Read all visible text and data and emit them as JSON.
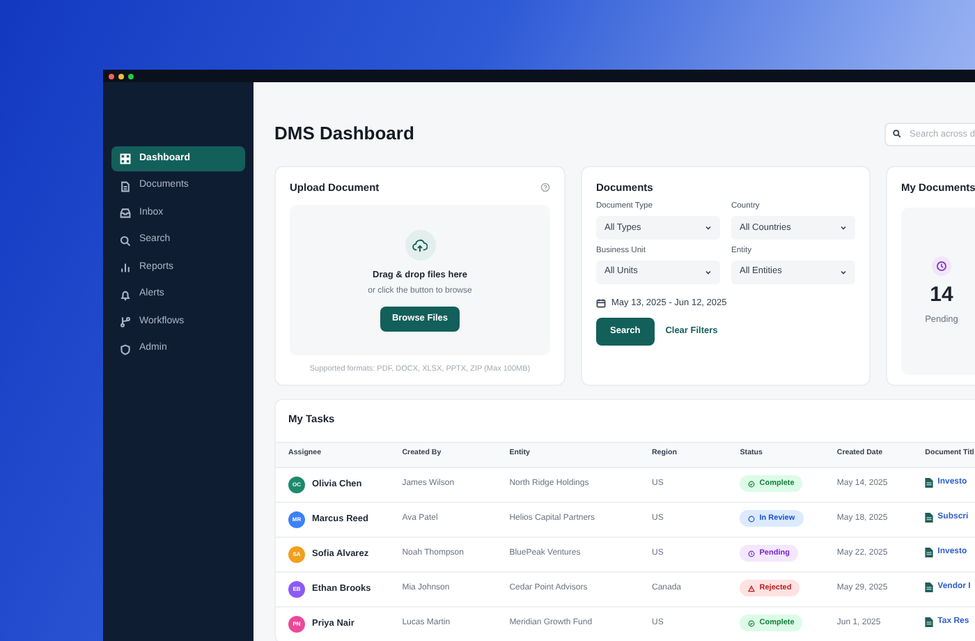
{
  "sidebar": {
    "items": [
      {
        "label": "Dashboard",
        "selected": true
      },
      {
        "label": "Documents",
        "selected": false
      },
      {
        "label": "Inbox",
        "selected": false
      },
      {
        "label": "Search",
        "selected": false
      },
      {
        "label": "Reports",
        "selected": false
      },
      {
        "label": "Alerts",
        "selected": false
      },
      {
        "label": "Workflows",
        "selected": false
      },
      {
        "label": "Admin",
        "selected": false
      }
    ]
  },
  "header": {
    "title": "DMS Dashboard",
    "search": {
      "placeholder": "Search across d"
    }
  },
  "upload_card": {
    "title": "Upload Document",
    "drop_title": "Drag & drop files here",
    "drop_subtitle": "or click the button to browse",
    "button": "Browse Files",
    "note": "Supported formats: PDF, DOCX, XLSX, PPTX, ZIP (Max 100MB)"
  },
  "documents_card": {
    "title": "Documents",
    "filters": [
      {
        "label": "Document Type",
        "value": "All Types"
      },
      {
        "label": "Country",
        "value": "All Countries"
      },
      {
        "label": "Business Unit",
        "value": "All Units"
      },
      {
        "label": "Entity",
        "value": "All Entities"
      }
    ],
    "date_range": "May 13, 2025 - Jun 12, 2025",
    "search_button": "Search",
    "clear_link": "Clear Filters"
  },
  "my_documents": {
    "title": "My Documents",
    "stat": {
      "value": "14",
      "label": "Pending"
    }
  },
  "tasks": {
    "title": "My Tasks",
    "columns": [
      "Assignee",
      "Created By",
      "Entity",
      "Region",
      "Status",
      "Created Date",
      "Document Titl"
    ],
    "rows": [
      {
        "initials": "OC",
        "color": "#1d8a6c",
        "assignee": "Olivia Chen",
        "created_by": "James Wilson",
        "entity": "North Ridge Holdings",
        "region": "US",
        "status": {
          "kind": "complete",
          "label": "Complete"
        },
        "created_date": "May 14, 2025",
        "document_title": "Investo"
      },
      {
        "initials": "MR",
        "color": "#3b82f6",
        "assignee": "Marcus Reed",
        "created_by": "Ava Patel",
        "entity": "Helios Capital Partners",
        "region": "US",
        "status": {
          "kind": "review",
          "label": "In Review"
        },
        "created_date": "May 18, 2025",
        "document_title": "Subscri"
      },
      {
        "initials": "SA",
        "color": "#f0a020",
        "assignee": "Sofia Alvarez",
        "created_by": "Noah Thompson",
        "entity": "BluePeak Ventures",
        "region": "US",
        "status": {
          "kind": "pending",
          "label": "Pending"
        },
        "created_date": "May 22, 2025",
        "document_title": "Investo"
      },
      {
        "initials": "EB",
        "color": "#8b5cf6",
        "assignee": "Ethan Brooks",
        "created_by": "Mia Johnson",
        "entity": "Cedar Point Advisors",
        "region": "Canada",
        "status": {
          "kind": "rejected",
          "label": "Rejected"
        },
        "created_date": "May 29, 2025",
        "document_title": "Vendor I"
      },
      {
        "initials": "PN",
        "color": "#ec4899",
        "assignee": "Priya Nair",
        "created_by": "Lucas Martin",
        "entity": "Meridian Growth Fund",
        "region": "US",
        "status": {
          "kind": "complete",
          "label": "Complete"
        },
        "created_date": "Jun 1, 2025",
        "document_title": "Tax Res"
      }
    ]
  }
}
